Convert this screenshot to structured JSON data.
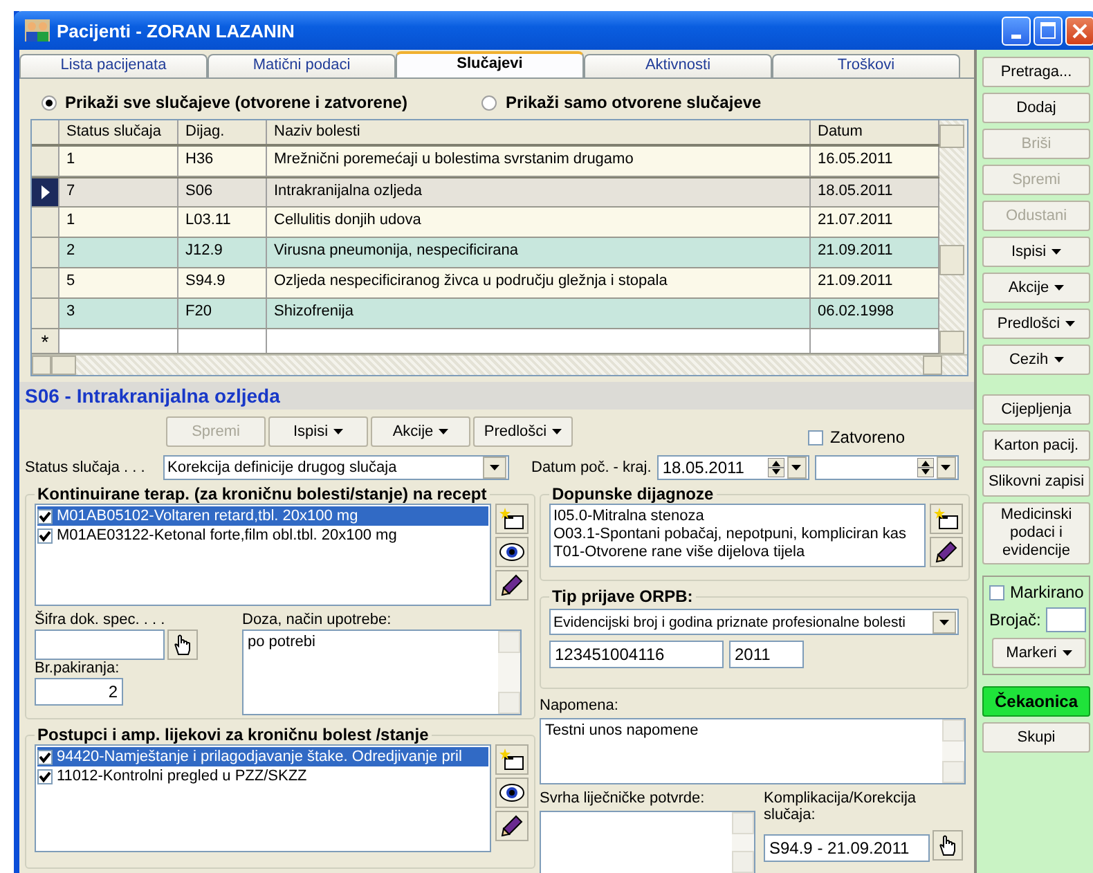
{
  "window": {
    "title": "Pacijenti - ZORAN LAZANIN"
  },
  "tabs": [
    {
      "label": "Lista pacijenata",
      "selected": false
    },
    {
      "label": "Matični podaci",
      "selected": false
    },
    {
      "label": "Slučajevi",
      "selected": true
    },
    {
      "label": "Aktivnosti",
      "selected": false
    },
    {
      "label": "Troškovi",
      "selected": false
    }
  ],
  "case_filter": [
    {
      "label": "Prikaži sve slučajeve (otvorene i zatvorene)",
      "selected": true
    },
    {
      "label": "Prikaži samo otvorene slučajeve",
      "selected": false
    }
  ],
  "cases_table": {
    "columns": [
      "Status slučaja",
      "Dijag.",
      "Naziv bolesti",
      "Datum"
    ],
    "rows": [
      {
        "cells": [
          "1",
          "H36",
          "Mrežnični poremećaji u bolestima svrstanim drugamo",
          "16.05.2011"
        ],
        "selected": false,
        "color": "#fbf9e9"
      },
      {
        "cells": [
          "7",
          "S06",
          "Intrakranijalna ozljeda",
          "18.05.2011"
        ],
        "selected": true,
        "color": "#e6e3da"
      },
      {
        "cells": [
          "1",
          "L03.11",
          "Cellulitis donjih udova",
          "21.07.2011"
        ],
        "selected": false,
        "color": "#fbf9e9"
      },
      {
        "cells": [
          "2",
          "J12.9",
          "Virusna pneumonija, nespecificirana",
          "21.09.2011"
        ],
        "selected": false,
        "color": "#c8e7dd"
      },
      {
        "cells": [
          "5",
          "S94.9",
          "Ozljeda nespecificiranog živca u području gležnja i stopala",
          "21.09.2011"
        ],
        "selected": false,
        "color": "#fbf9e9"
      },
      {
        "cells": [
          "3",
          "F20",
          "Shizofrenija",
          "06.02.1998"
        ],
        "selected": false,
        "color": "#c8e7dd"
      }
    ],
    "new_row_marker": "*"
  },
  "case": {
    "title": "S06 - Intrakranijalna ozljeda",
    "buttons": [
      {
        "label": "Spremi",
        "disabled": true,
        "dropdown": false
      },
      {
        "label": "Ispisi",
        "disabled": false,
        "dropdown": true
      },
      {
        "label": "Akcije",
        "disabled": false,
        "dropdown": true
      },
      {
        "label": "Predlošci",
        "disabled": false,
        "dropdown": true
      }
    ],
    "closed": {
      "label": "Zatvoreno",
      "checked": false
    },
    "status": {
      "label": "Status slučaja . . .",
      "value": "Korekcija definicije drugog slučaja"
    },
    "period": {
      "label": "Datum poč. - kraj.",
      "start": "18.05.2011"
    },
    "therapies": {
      "title": "Kontinuirane terap. (za kroničnu bolesti/stanje) na recept",
      "items": [
        {
          "text": "M01AB05102-Voltaren retard,tbl. 20x100 mg",
          "checked": true,
          "selected": true
        },
        {
          "text": "M01AE03122-Ketonal forte,film obl.tbl. 20x100 mg",
          "checked": true,
          "selected": false
        }
      ]
    },
    "specialist_code": {
      "label": "Šifra dok. spec. . . ."
    },
    "dosage": {
      "label": "Doza, način upotrebe:",
      "value": "po potrebi"
    },
    "packages": {
      "label": "Br.pakiranja:",
      "value": "2"
    },
    "procedures": {
      "title": "Postupci i amp. lijekovi za kroničnu bolest /stanje",
      "items": [
        {
          "text": "94420-Namještanje i prilagodjavanje štake. Odredjivanje pril",
          "checked": true,
          "selected": true
        },
        {
          "text": "11012-Kontrolni pregled u PZZ/SKZZ",
          "checked": true,
          "selected": false
        }
      ]
    },
    "additional_diagnoses": {
      "title": "Dopunske dijagnoze",
      "items": [
        "I05.0-Mitralna stenoza",
        "O03.1-Spontani pobačaj, nepotpuni, kompliciran kas",
        "T01-Otvorene rane više dijelova tijela"
      ]
    },
    "orpb": {
      "title": "Tip prijave ORPB:",
      "type": "Evidencijski broj i godina priznate profesionalne bolesti",
      "number": "123451004116",
      "year": "2011"
    },
    "note": {
      "label": "Napomena:",
      "value": "Testni unos napomene"
    },
    "certificate_purpose": {
      "label": "Svrha liječničke potvrde:"
    },
    "complication": {
      "label": "Komplikacija/Korekcija slučaja:",
      "value": "S94.9 - 21.09.2011"
    }
  },
  "sidebar": {
    "actions": [
      {
        "label": "Pretraga...",
        "disabled": false,
        "dropdown": false
      },
      {
        "label": "Dodaj",
        "disabled": false,
        "dropdown": false
      },
      {
        "label": "Briši",
        "disabled": true,
        "dropdown": false
      },
      {
        "label": "Spremi",
        "disabled": true,
        "dropdown": false
      },
      {
        "label": "Odustani",
        "disabled": true,
        "dropdown": false
      },
      {
        "label": "Ispisi",
        "disabled": false,
        "dropdown": true
      },
      {
        "label": "Akcije",
        "disabled": false,
        "dropdown": true
      },
      {
        "label": "Predlošci",
        "disabled": false,
        "dropdown": true
      },
      {
        "label": "Cezih",
        "disabled": false,
        "dropdown": true
      }
    ],
    "modules": [
      {
        "label": "Cijepljenja",
        "disabled": false,
        "dropdown": false
      },
      {
        "label": "Karton pacij.",
        "disabled": false,
        "dropdown": false
      },
      {
        "label": "Slikovni zapisi",
        "disabled": false,
        "dropdown": false
      },
      {
        "label": "Medicinski podaci i evidencije",
        "disabled": false,
        "dropdown": false
      }
    ],
    "marked": {
      "label": "Markirano",
      "checked": false
    },
    "counter": {
      "label": "Brojač:"
    },
    "markers": {
      "label": "Markeri",
      "disabled": false,
      "dropdown": true
    },
    "bottom": [
      {
        "label": "Čekaonica",
        "highlighted": true
      },
      {
        "label": "Skupi",
        "highlighted": false
      }
    ]
  }
}
